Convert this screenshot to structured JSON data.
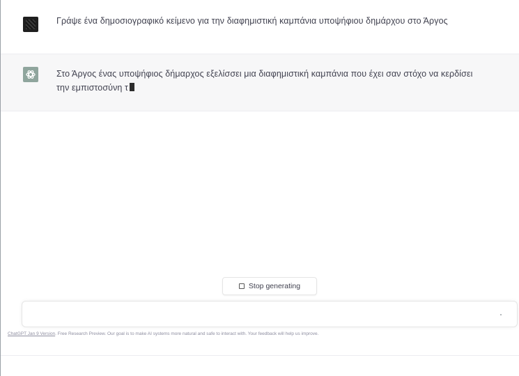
{
  "messages": {
    "user_text": "Γράψε ένα δημοσιογραφικό κείμενο για την διαφημιστική καμπάνια υποψήφιου δημάρχου στο Άργος",
    "assistant_text": "Στο Άργος ένας υποψήφιος δήμαρχος εξελίσσει μια διαφημιστική καμπάνια που έχει σαν στόχο να κερδίσει την εμπιστοσύνη τ"
  },
  "controls": {
    "stop_label": "Stop generating",
    "stop_icon": "square-icon",
    "input_value": ""
  },
  "footer": {
    "version_link": "ChatGPT Jan 9 Version",
    "text": ". Free Research Preview. Our goal is to make AI systems more natural and safe to interact with. Your feedback will help us improve."
  },
  "colors": {
    "assistant_bg": "#f7f7f8",
    "assistant_avatar": "#8fa59d",
    "text": "#40414f"
  }
}
